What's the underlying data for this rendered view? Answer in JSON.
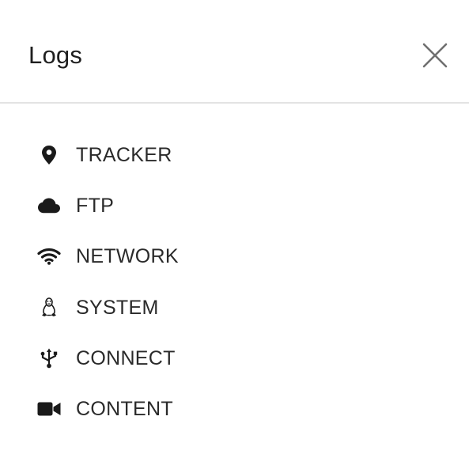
{
  "header": {
    "title": "Logs",
    "close_icon": "close-icon"
  },
  "menu": {
    "items": [
      {
        "label": "TRACKER",
        "icon": "map-marker-icon"
      },
      {
        "label": "FTP",
        "icon": "cloud-icon"
      },
      {
        "label": "NETWORK",
        "icon": "wifi-icon"
      },
      {
        "label": "SYSTEM",
        "icon": "linux-icon"
      },
      {
        "label": "CONNECT",
        "icon": "usb-icon"
      },
      {
        "label": "CONTENT",
        "icon": "video-camera-icon"
      }
    ]
  },
  "colors": {
    "text": "#2a2a2a",
    "icon": "#1a1a1a",
    "divider": "#e3e3e3",
    "close": "#707070"
  }
}
